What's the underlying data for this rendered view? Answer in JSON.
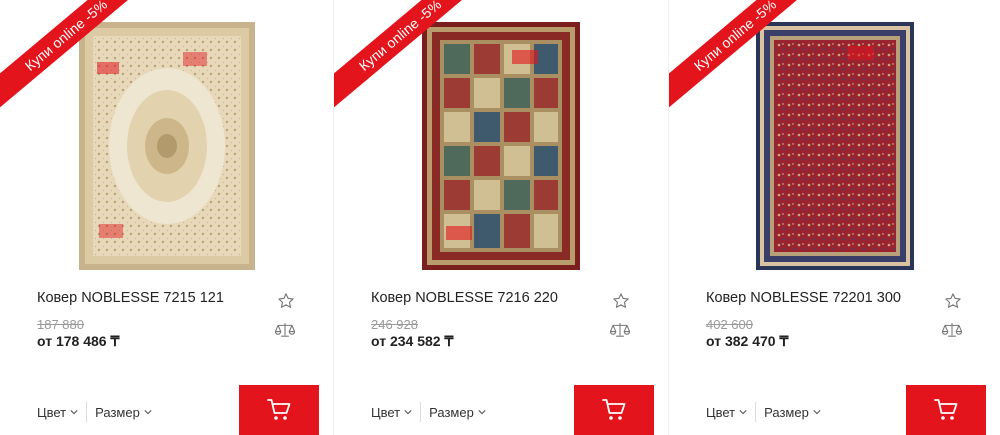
{
  "products": [
    {
      "badge": "Купи online -5%",
      "title": "Ковер NOBLESSE 7215 121",
      "old_price": "187 880",
      "price": "от 178 486 ₸",
      "options": {
        "color": "Цвет",
        "size": "Размер"
      },
      "colors": {
        "field": "#e3d4b3",
        "border": "#cbb48e",
        "accent": "#efe5cf",
        "medallion": "#d8c59a"
      }
    },
    {
      "badge": "Купи online -5%",
      "title": "Ковер NOBLESSE 7216 220",
      "old_price": "246 928",
      "price": "от 234 582 ₸",
      "options": {
        "color": "Цвет",
        "size": "Размер"
      },
      "colors": {
        "field": "#8a2a25",
        "border": "#7a1f1e",
        "accent": "#c4a878",
        "medallion": "#4f6a5b"
      }
    },
    {
      "badge": "Купи online -5%",
      "title": "Ковер NOBLESSE 72201 300",
      "old_price": "402 600",
      "price": "от 382 470 ₸",
      "options": {
        "color": "Цвет",
        "size": "Размер"
      },
      "colors": {
        "field": "#9a2330",
        "border": "#2a3557",
        "accent": "#d9c3a3",
        "medallion": "#b23a44"
      }
    }
  ],
  "ui": {
    "accent": "#e3141b",
    "icons": [
      "star-icon",
      "scales-icon",
      "cart-icon",
      "chevron-down-icon"
    ]
  }
}
